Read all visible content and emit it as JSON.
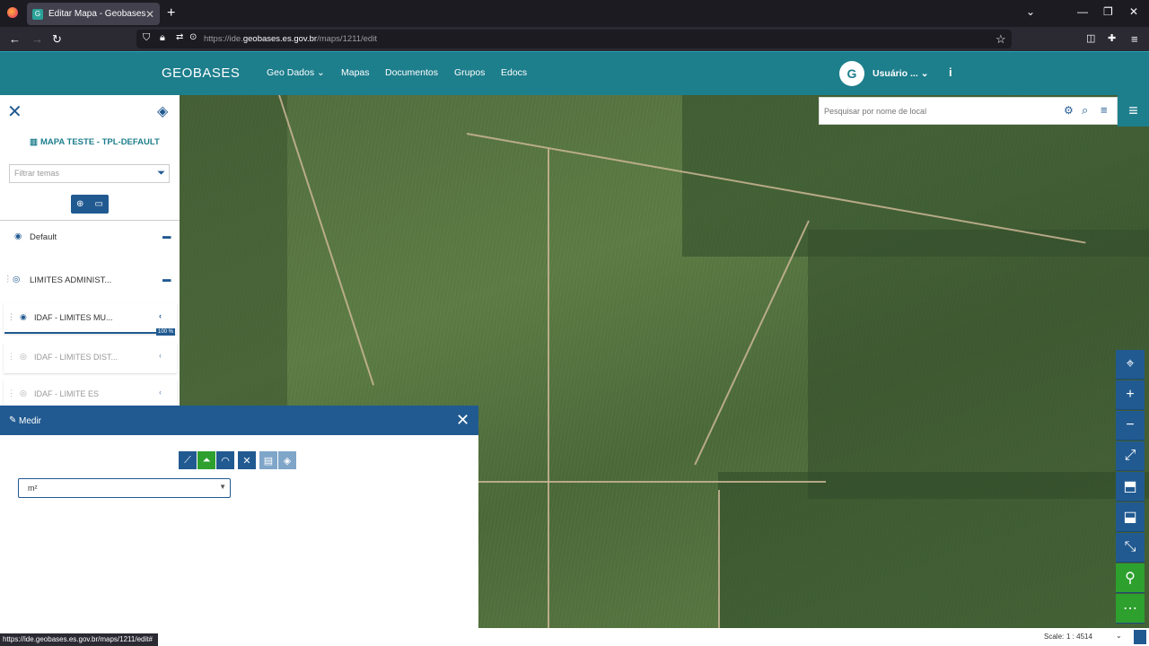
{
  "browser": {
    "tab_title": "Editar Mapa - Geobases -",
    "url_prefix": "https://ide.",
    "url_domain": "geobases.es.gov.br",
    "url_path": "/maps/1211/edit",
    "status_url": "https://ide.geobases.es.gov.br/maps/1211/edit#"
  },
  "header": {
    "logo": "GEOBASES",
    "nav": [
      "Geo Dados",
      "Mapas",
      "Documentos",
      "Grupos",
      "Edocs"
    ],
    "user": "Usuário ...",
    "info_icon": "info-icon"
  },
  "search": {
    "placeholder": "Pesquisar por nome de local"
  },
  "sidebar": {
    "map_title": "MAPA TESTE - TPL-DEFAULT",
    "filter_placeholder": "Filtrar temas",
    "layers": [
      {
        "label": "Default"
      },
      {
        "label": "LIMITES ADMINIST..."
      }
    ],
    "sublayers": [
      {
        "label": "IDAF - LIMITES MU...",
        "opacity": "100 %"
      },
      {
        "label": "IDAF - LIMITES DIST..."
      },
      {
        "label": "IDAF - LIMITE ES"
      }
    ]
  },
  "measure": {
    "title": "Medir",
    "unit": "m²"
  },
  "scale": {
    "label": "Scale:",
    "value": "1 : 4514"
  },
  "colors": {
    "header": "#1d7e8c",
    "panel": "#215a91",
    "green": "#2ea02e"
  }
}
